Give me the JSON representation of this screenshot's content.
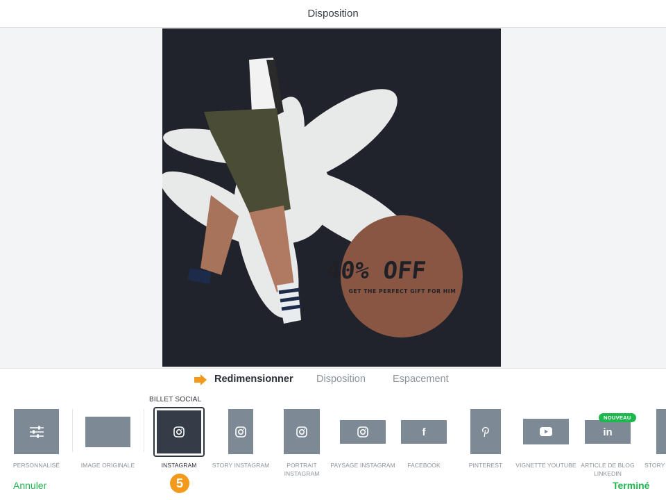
{
  "header": {
    "title": "Disposition"
  },
  "design": {
    "headline": "40% OFF",
    "tagline": "GET THE PERFECT GIFT FOR HIM",
    "colors": {
      "background": "#20232b",
      "badge": "#8a5644",
      "shape": "#e8e9e9"
    }
  },
  "tabs": [
    {
      "label": "Redimensionner",
      "active": true
    },
    {
      "label": "Disposition",
      "active": false
    },
    {
      "label": "Espacement",
      "active": false
    }
  ],
  "tray": {
    "section_label": "BILLET SOCIAL",
    "presets": [
      {
        "label": "PERSONNALISÉ",
        "icon": "sliders-icon"
      },
      {
        "label": "IMAGE ORIGINALE",
        "icon": ""
      },
      {
        "label": "INSTAGRAM",
        "icon": "instagram-icon",
        "selected": true
      },
      {
        "label": "STORY INSTAGRAM",
        "icon": "instagram-icon"
      },
      {
        "label": "PORTRAIT",
        "label2": "INSTAGRAM",
        "icon": "instagram-icon"
      },
      {
        "label": "PAYSAGE INSTAGRAM",
        "icon": "instagram-icon"
      },
      {
        "label": "FACEBOOK",
        "icon": "facebook-icon"
      },
      {
        "label": "PINTEREST",
        "icon": "pinterest-icon"
      },
      {
        "label": "VIGNETTE YOUTUBE",
        "icon": "youtube-icon"
      },
      {
        "label": "ARTICLE DE BLOG",
        "label2": "LINKEDIN",
        "icon": "linkedin-icon",
        "badge": "NOUVEAU"
      },
      {
        "label": "STORY S",
        "icon": ""
      }
    ]
  },
  "footer": {
    "cancel": "Annuler",
    "done": "Terminé",
    "step": "5"
  },
  "colors": {
    "accent": "#1db84e",
    "arrow": "#f39a1d",
    "thumb": "#7d8a95",
    "selected_thumb": "#333c47"
  }
}
